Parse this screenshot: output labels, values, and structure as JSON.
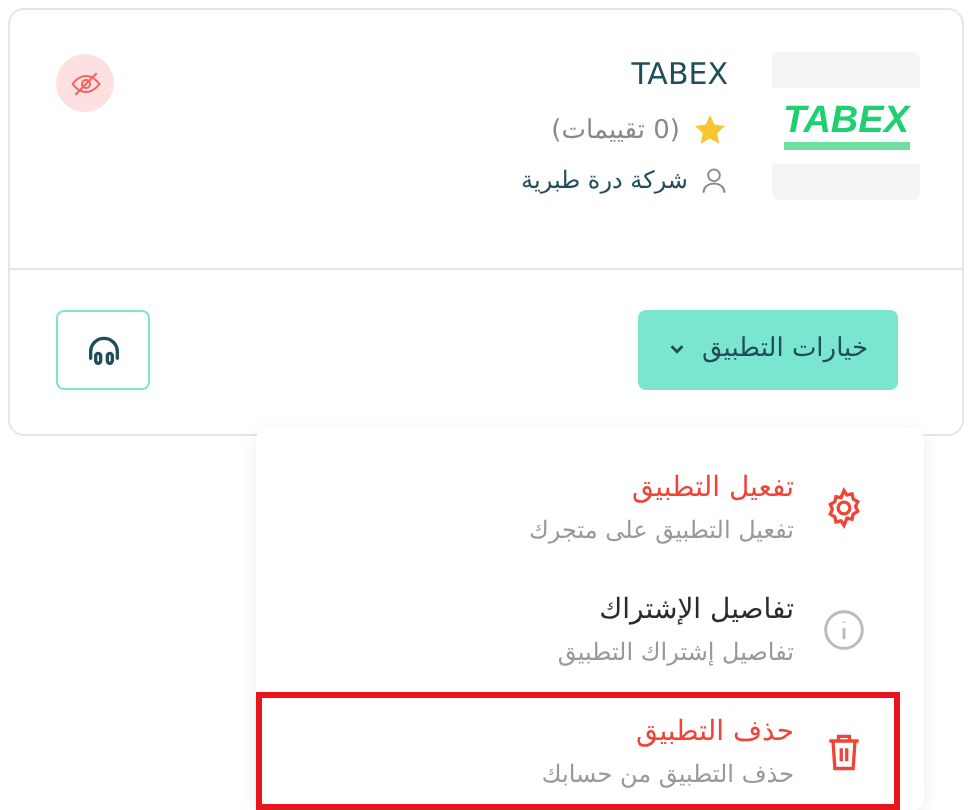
{
  "app_card": {
    "logo_text": "TABEX",
    "name": "TABEX",
    "rating_text": "(0 تقييمات)",
    "developer": "شركة درة طبرية",
    "options_button": "خيارات التطبيق"
  },
  "menu": {
    "expanded": true,
    "items": [
      {
        "title": "تفعيل التطبيق",
        "subtitle": "تفعيل التطبيق على متجرك",
        "color": "#f04438",
        "highlighted": false
      },
      {
        "title": "تفاصيل الإشتراك",
        "subtitle": "تفاصيل إشتراك التطبيق",
        "color": "#2b2b2b",
        "highlighted": false
      },
      {
        "title": "حذف التطبيق",
        "subtitle": "حذف التطبيق من حسابك",
        "color": "#f04438",
        "highlighted": true
      }
    ]
  }
}
